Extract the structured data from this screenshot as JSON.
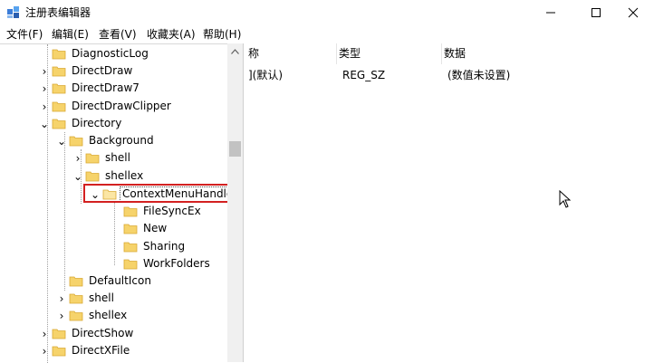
{
  "window": {
    "title": "注册表编辑器",
    "min_glyph": "—",
    "max_glyph": "☐",
    "close_glyph": "✕"
  },
  "menu": [
    "文件(F)",
    "编辑(E)",
    "查看(V)",
    "收藏夹(A)",
    "帮助(H)"
  ],
  "tree": [
    {
      "label": "DiagnosticLog",
      "arrow": ""
    },
    {
      "label": "DirectDraw",
      "arrow": "›"
    },
    {
      "label": "DirectDraw7",
      "arrow": "›"
    },
    {
      "label": "DirectDrawClipper",
      "arrow": "›"
    },
    {
      "label": "Directory",
      "arrow": "⌄"
    },
    {
      "label": "Background",
      "arrow": "⌄"
    },
    {
      "label": "shell",
      "arrow": "›"
    },
    {
      "label": "shellex",
      "arrow": "⌄"
    },
    {
      "label": "ContextMenuHandle",
      "arrow": "⌄"
    },
    {
      "label": "FileSyncEx",
      "arrow": ""
    },
    {
      "label": "New",
      "arrow": ""
    },
    {
      "label": "Sharing",
      "arrow": ""
    },
    {
      "label": "WorkFolders",
      "arrow": ""
    },
    {
      "label": "DefaultIcon",
      "arrow": ""
    },
    {
      "label": "shell",
      "arrow": "›"
    },
    {
      "label": "shellex",
      "arrow": "›"
    },
    {
      "label": "DirectShow",
      "arrow": "›"
    },
    {
      "label": "DirectXFile",
      "arrow": "›"
    }
  ],
  "columns": {
    "name": "称",
    "type": "类型",
    "data": "数据"
  },
  "rows": [
    {
      "name": "](默认)",
      "type": "REG_SZ",
      "data": "(数值未设置)"
    }
  ],
  "colors": {
    "folder": "#f6d36b",
    "folder_edge": "#d9a933",
    "highlight": "#d32020"
  },
  "icons": {
    "app": "registry-icon",
    "folder": "folder-icon"
  }
}
